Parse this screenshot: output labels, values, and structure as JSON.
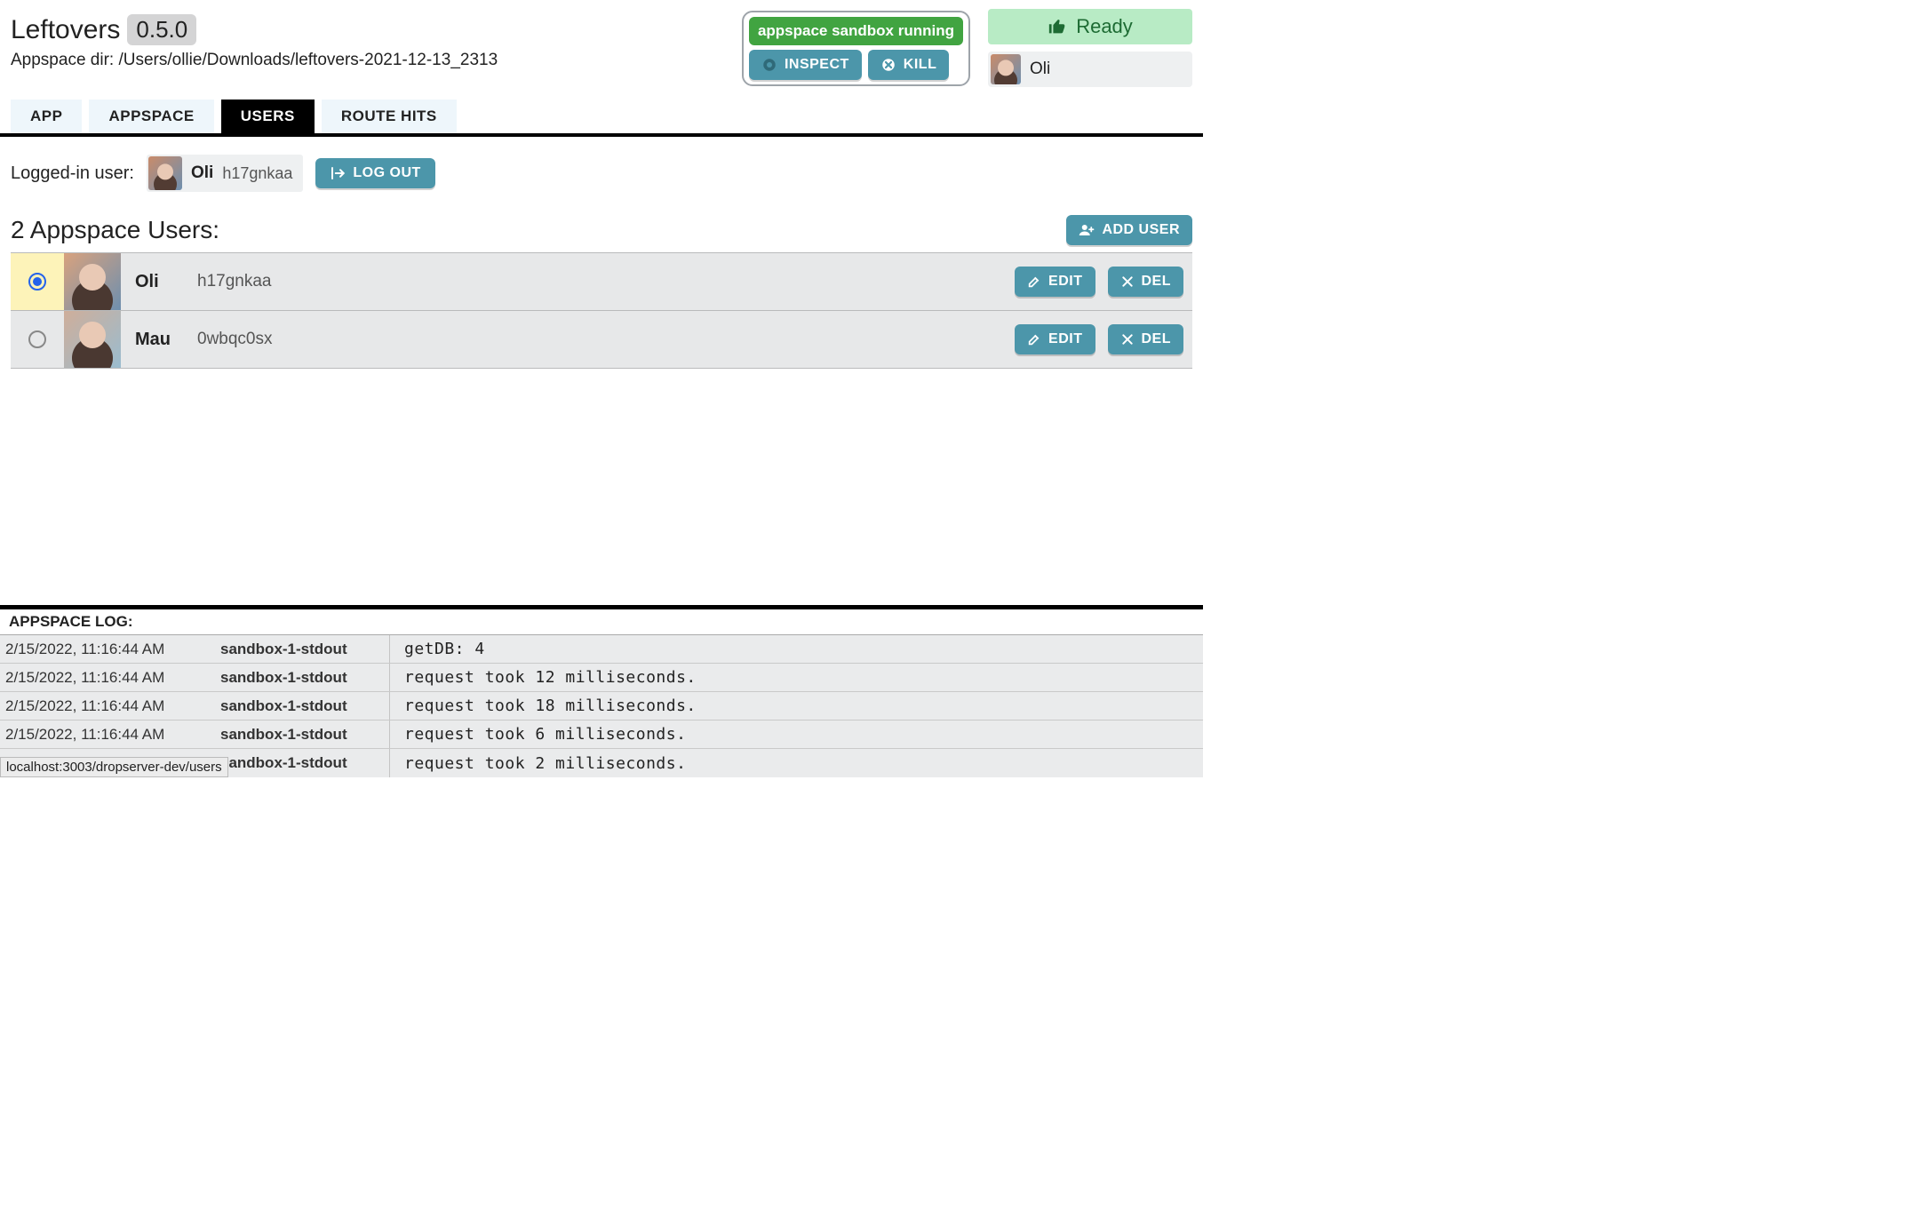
{
  "app": {
    "name": "Leftovers",
    "version": "0.5.0"
  },
  "dir": {
    "label": "Appspace dir:",
    "path": "/Users/ollie/Downloads/leftovers-2021-12-13_2313"
  },
  "sandbox": {
    "status": "appspace sandbox running",
    "inspect_label": "INSPECT",
    "kill_label": "KILL"
  },
  "ready": {
    "label": "Ready",
    "user_name": "Oli"
  },
  "tabs": {
    "app": "APP",
    "appspace": "APPSPACE",
    "users": "USERS",
    "route_hits": "ROUTE HITS",
    "active": "users"
  },
  "logged_in": {
    "label": "Logged-in user:",
    "name": "Oli",
    "id": "h17gnkaa",
    "logout_label": "LOG OUT"
  },
  "users_section": {
    "title": "2 Appspace Users:",
    "add_label": "ADD USER",
    "edit_label": "EDIT",
    "del_label": "DEL",
    "rows": [
      {
        "name": "Oli",
        "id": "h17gnkaa",
        "selected": true
      },
      {
        "name": "Mau",
        "id": "0wbqc0sx",
        "selected": false
      }
    ]
  },
  "log": {
    "header": "APPSPACE LOG:",
    "rows": [
      {
        "ts": "2/15/2022, 11:16:44 AM",
        "src": "sandbox-1-stdout",
        "msg": "getDB: 4"
      },
      {
        "ts": "2/15/2022, 11:16:44 AM",
        "src": "sandbox-1-stdout",
        "msg": "request took 12 milliseconds."
      },
      {
        "ts": "2/15/2022, 11:16:44 AM",
        "src": "sandbox-1-stdout",
        "msg": "request took 18 milliseconds."
      },
      {
        "ts": "2/15/2022, 11:16:44 AM",
        "src": "sandbox-1-stdout",
        "msg": "request took 6 milliseconds."
      },
      {
        "ts": "2/15/2022, 11:16:44 AM",
        "src": "sandbox-1-stdout",
        "msg": "request took 2 milliseconds."
      }
    ]
  },
  "status_bar_url": "localhost:3003/dropserver-dev/users"
}
